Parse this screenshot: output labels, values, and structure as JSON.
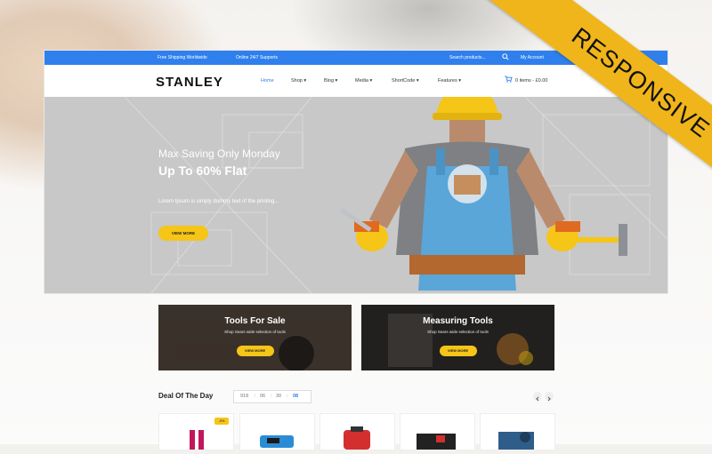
{
  "topbar": {
    "shipping": "Free Shipping Worldwide",
    "support": "Online 24/7 Supports",
    "search_placeholder": "Search products...",
    "account": "My Account"
  },
  "header": {
    "logo": "STANLEY",
    "nav": [
      {
        "label": "Home"
      },
      {
        "label": "Shop"
      },
      {
        "label": "Blog"
      },
      {
        "label": "Media"
      },
      {
        "label": "ShortCode"
      },
      {
        "label": "Features"
      }
    ],
    "cart": "0 items - £0.00"
  },
  "hero": {
    "subtitle": "Max Saving Only Monday",
    "title": "Up To 60% Flat",
    "text": "Lorem Ipsum is simply dummy text of the printing...",
    "button": "VIEW MORE"
  },
  "banners": [
    {
      "title": "Tools For Sale",
      "subtitle": "Shop Sears wide selection of tools",
      "button": "VIEW MORE"
    },
    {
      "title": "Measuring Tools",
      "subtitle": "Shop Sears wide selection of tools",
      "button": "VIEW MORE"
    }
  ],
  "deal": {
    "title": "Deal Of The Day",
    "timer": [
      "918",
      "06",
      "30",
      "08"
    ],
    "sale_badge": "-9%"
  },
  "ribbon": "RESPONSIVE",
  "colors": {
    "accent_blue": "#2f80ed",
    "accent_yellow": "#f5c518",
    "ribbon": "#f0b51a"
  }
}
